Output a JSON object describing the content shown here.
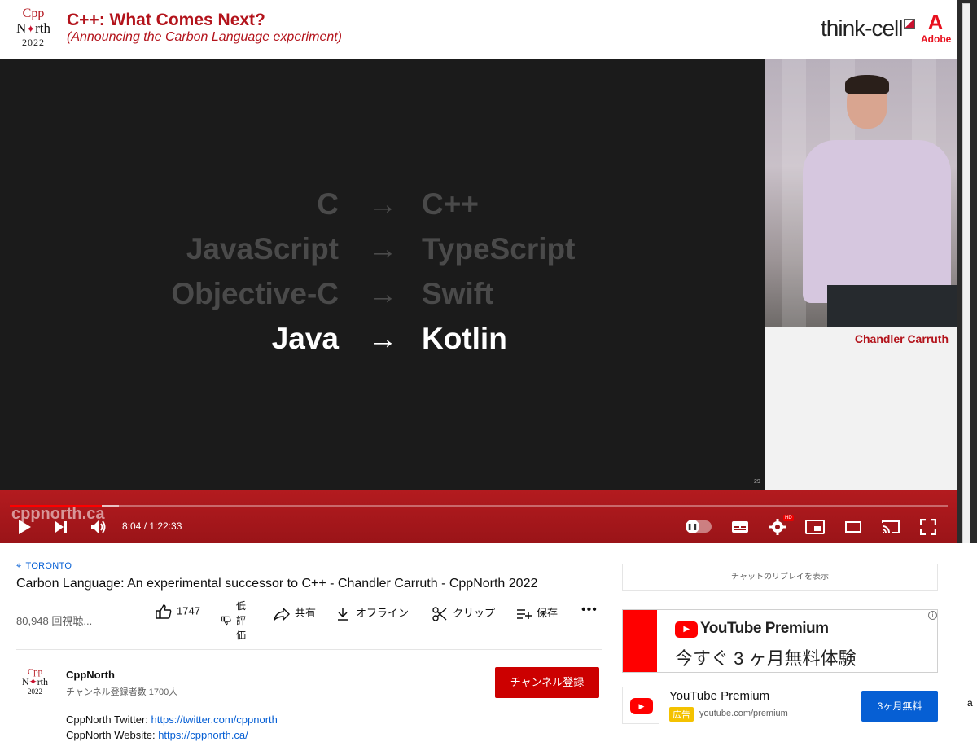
{
  "video_header": {
    "logo_line1": "Cpp",
    "logo_line2": "North",
    "logo_year": "2022",
    "talk_title": "C++: What Comes Next?",
    "talk_subtitle": "(Announcing the Carbon Language experiment)",
    "sponsor1": "think-cell",
    "sponsor2": "Adobe"
  },
  "slide": {
    "rows": [
      {
        "src": "C",
        "arrow": "→",
        "dst": "C++"
      },
      {
        "src": "JavaScript",
        "arrow": "→",
        "dst": "TypeScript"
      },
      {
        "src": "Objective-C",
        "arrow": "→",
        "dst": "Swift"
      },
      {
        "src": "Java",
        "arrow": "→",
        "dst": "Kotlin"
      }
    ],
    "slide_number": "29"
  },
  "speaker": {
    "name": "Chandler Carruth"
  },
  "player": {
    "watermark": "cppnorth.ca",
    "time": "8:04 / 1:22:33",
    "played_fraction": 0.098,
    "loaded_fraction": 0.116,
    "hd_badge": "HD",
    "icons": {
      "play": "play-icon",
      "next": "skip-next-icon",
      "volume": "volume-icon",
      "autoplay": "autoplay-toggle",
      "subtitles": "subtitles-icon",
      "settings": "gear-icon",
      "miniplayer": "miniplayer-icon",
      "theater": "theater-mode-icon",
      "cast": "cast-icon",
      "fullscreen": "fullscreen-icon"
    }
  },
  "info": {
    "location": "TORONTO",
    "title": "Carbon Language: An experimental successor to C++ - Chandler Carruth - CppNorth 2022",
    "views": "80,948 回視聴...",
    "likes": "1747",
    "dislike": "低評価",
    "share": "共有",
    "offline": "オフライン",
    "clip": "クリップ",
    "save": "保存",
    "more": "•••"
  },
  "channel": {
    "name": "CppNorth",
    "subscribers": "チャンネル登録者数 1700人",
    "subscribe": "チャンネル登録",
    "desc_twitter_label": "CppNorth Twitter: ",
    "desc_twitter_url": "https://twitter.com/cppnorth",
    "desc_website_label": "CppNorth Website: ",
    "desc_website_url": "https://cppnorth.ca/"
  },
  "sidebar": {
    "chat_replay": "チャットのリプレイを表示",
    "promo_logo": "YouTube Premium",
    "promo_headline": "今すぐ 3 ヶ月無料体験",
    "promo_info": "i",
    "ad_title": "YouTube Premium",
    "ad_badge": "広告",
    "ad_url": "youtube.com/premium",
    "ad_cta": "3ヶ月無料"
  },
  "edge_letter": "a",
  "colors": {
    "brand_red": "#b3131b",
    "youtube_red": "#ff0000",
    "link_blue": "#065fd4"
  }
}
